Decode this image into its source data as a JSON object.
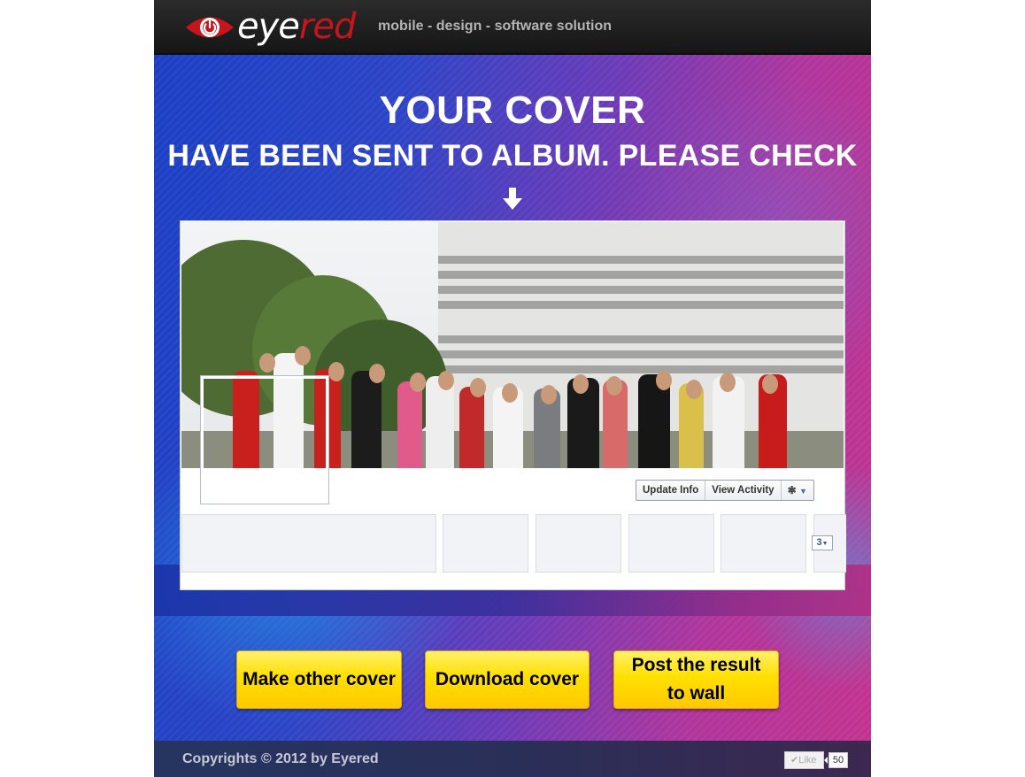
{
  "header": {
    "logo": {
      "part1": "eye",
      "part2": "red",
      "icon": "power-eye-icon"
    },
    "tagline": "mobile - design - software solution"
  },
  "hero": {
    "title_line1": "YOUR COVER",
    "title_line2": "HAVE BEEN SENT TO ALBUM. PLEASE CHECK",
    "arrow_icon": "arrow-down-icon"
  },
  "preview": {
    "update_info_label": "Update Info",
    "view_activity_label": "View Activity",
    "settings_icon": "gear-icon",
    "more_count": "3"
  },
  "actions": {
    "make_other_label": "Make other cover",
    "download_label": "Download cover",
    "post_label": "Post the result to wall"
  },
  "footer": {
    "copyright": "Copyrights © 2012 by Eyered",
    "like_label": "Like",
    "like_count": "50"
  },
  "colors": {
    "brand_red": "#c4161c",
    "button_yellow": "#ffe000",
    "facebook_blue": "#3b5998"
  }
}
